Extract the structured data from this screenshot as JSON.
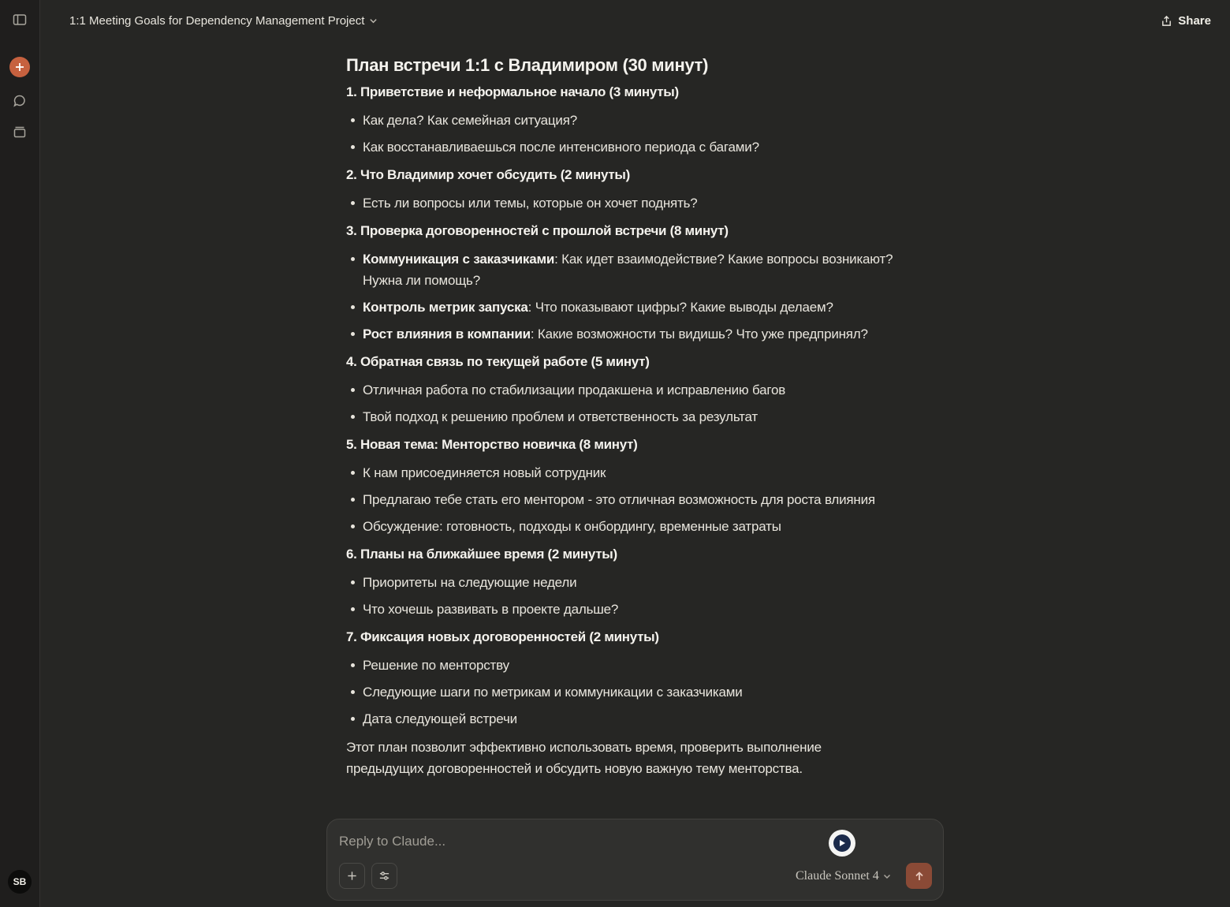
{
  "header": {
    "title": "1:1 Meeting Goals for Dependency Management Project",
    "share_label": "Share"
  },
  "sidebar": {
    "icons": [
      "sidebar-toggle-icon",
      "new-chat-icon",
      "search-chats-icon",
      "projects-icon"
    ],
    "avatar_initials": "SB",
    "accent_color": "#c6613f"
  },
  "doc": {
    "title": "План встречи 1:1 с Владимиром (30 минут)",
    "sections": [
      {
        "heading": "1. Приветствие и неформальное начало (3 минуты)",
        "items": [
          {
            "lead": "",
            "text": "Как дела? Как семейная ситуация?"
          },
          {
            "lead": "",
            "text": "Как восстанавливаешься после интенсивного периода с багами?"
          }
        ]
      },
      {
        "heading": "2. Что Владимир хочет обсудить (2 минуты)",
        "items": [
          {
            "lead": "",
            "text": "Есть ли вопросы или темы, которые он хочет поднять?"
          }
        ]
      },
      {
        "heading": "3. Проверка договоренностей с прошлой встречи (8 минут)",
        "items": [
          {
            "lead": "Коммуникация с заказчиками",
            "text": ": Как идет взаимодействие? Какие вопросы возникают? Нужна ли помощь?"
          },
          {
            "lead": "Контроль метрик запуска",
            "text": ": Что показывают цифры? Какие выводы делаем?"
          },
          {
            "lead": "Рост влияния в компании",
            "text": ": Какие возможности ты видишь? Что уже предпринял?"
          }
        ]
      },
      {
        "heading": "4. Обратная связь по текущей работе (5 минут)",
        "items": [
          {
            "lead": "",
            "text": "Отличная работа по стабилизации продакшена и исправлению багов"
          },
          {
            "lead": "",
            "text": "Твой подход к решению проблем и ответственность за результат"
          }
        ]
      },
      {
        "heading": "5. Новая тема: Менторство новичка (8 минут)",
        "items": [
          {
            "lead": "",
            "text": "К нам присоединяется новый сотрудник"
          },
          {
            "lead": "",
            "text": "Предлагаю тебе стать его ментором - это отличная возможность для роста влияния"
          },
          {
            "lead": "",
            "text": "Обсуждение: готовность, подходы к онбордингу, временные затраты"
          }
        ]
      },
      {
        "heading": "6. Планы на ближайшее время (2 минуты)",
        "items": [
          {
            "lead": "",
            "text": "Приоритеты на следующие недели"
          },
          {
            "lead": "",
            "text": "Что хочешь развивать в проекте дальше?"
          }
        ]
      },
      {
        "heading": "7. Фиксация новых договоренностей (2 минуты)",
        "items": [
          {
            "lead": "",
            "text": "Решение по менторству"
          },
          {
            "lead": "",
            "text": "Следующие шаги по метрикам и коммуникации с заказчиками"
          },
          {
            "lead": "",
            "text": "Дата следующей встречи"
          }
        ]
      }
    ],
    "conclusion": "Этот план позволит эффективно использовать время, проверить выполнение предыдущих договоренностей и обсудить новую важную тему менторства."
  },
  "composer": {
    "placeholder": "Reply to Claude...",
    "value": "",
    "model_label": "Claude Sonnet 4",
    "send_color": "#8a4a36"
  }
}
